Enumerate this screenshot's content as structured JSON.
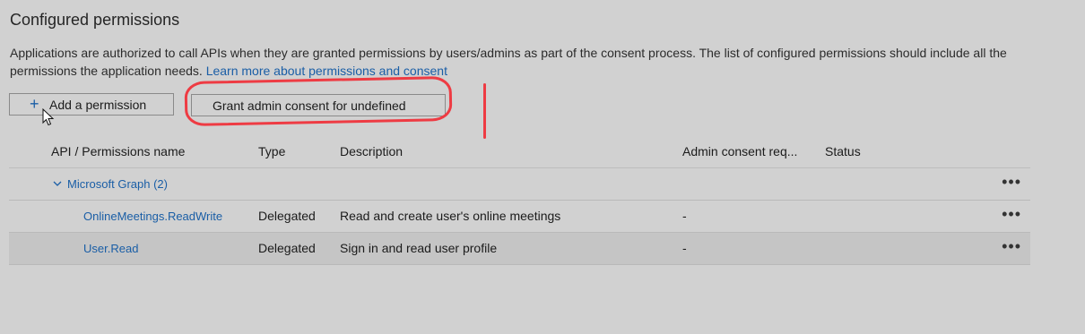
{
  "section": {
    "title": "Configured permissions",
    "description": "Applications are authorized to call APIs when they are granted permissions by users/admins as part of the consent process. The list of configured permissions should include all the permissions the application needs.",
    "learn_more": "Learn more about permissions and consent"
  },
  "toolbar": {
    "add_label": "Add a permission",
    "grant_label": "Grant admin consent for undefined"
  },
  "table": {
    "headers": [
      "API / Permissions name",
      "Type",
      "Description",
      "Admin consent req...",
      "Status"
    ],
    "group": {
      "label": "Microsoft Graph (2)",
      "more": "•••"
    },
    "rows": [
      {
        "name": "OnlineMeetings.ReadWrite",
        "type": "Delegated",
        "description": "Read and create user's online meetings",
        "admin": "-",
        "status": "",
        "more": "•••"
      },
      {
        "name": "User.Read",
        "type": "Delegated",
        "description": "Sign in and read user profile",
        "admin": "-",
        "status": "",
        "more": "•••"
      }
    ]
  },
  "icons": {
    "add": "plus-icon",
    "expand": "chevron-down-icon",
    "more": "more-actions-icon",
    "cursor": "mouse-pointer-icon"
  },
  "colors": {
    "background": "#d1d1d1",
    "link": "#1a5ea6",
    "annotation": "#ee3b43",
    "selected_row": "#c5c5c5"
  }
}
